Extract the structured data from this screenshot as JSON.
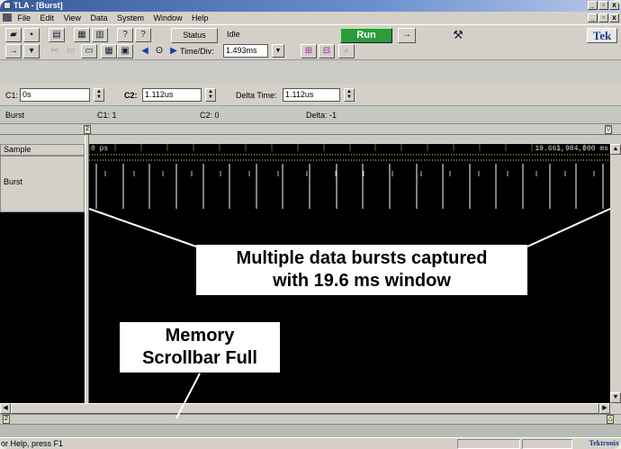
{
  "window": {
    "title": "TLA - [Burst]",
    "min_glyph": "_",
    "max_glyph": "▫",
    "close_glyph": "x"
  },
  "menu": {
    "items": [
      "File",
      "Edit",
      "View",
      "Data",
      "System",
      "Window",
      "Help"
    ]
  },
  "toolbar": {
    "status_label": "Status",
    "status_text": "Idle",
    "run_label": "Run",
    "arrow_glyph": "→",
    "brand_label": "Tek",
    "time_div_label": "Time/Div:",
    "time_div_value": "1.493ms"
  },
  "cursors": {
    "c1_label": "C1:",
    "c1_value": "0s",
    "c2_label": "C2:",
    "c2_value": "1.112us",
    "delta_label": "Delta Time:",
    "delta_value": "1.112us"
  },
  "info_row": {
    "name": "Burst",
    "c1": "C1: 1",
    "c2": "C2: 0",
    "delta": "Delta: -1"
  },
  "waveform": {
    "header_label": "Sample",
    "channel_label": "Burst",
    "time_start": "0 ps",
    "time_end": "19.661,984,000 ms",
    "marker_left": "2",
    "marker_bottom": "2",
    "burst_count_lines": 20,
    "colors": {
      "background": "#000000",
      "burst_line": "#ffffff",
      "sample_dots": "#e8d878",
      "grid": "#4a6a4a"
    }
  },
  "annotations": {
    "bursts_line1": "Multiple data bursts captured",
    "bursts_line2": "with 19.6 ms window",
    "scroll_line1": "Memory",
    "scroll_line2": "Scrollbar Full"
  },
  "statusbar": {
    "help_text": "or Help, press F1",
    "brand": "Tektronix"
  }
}
